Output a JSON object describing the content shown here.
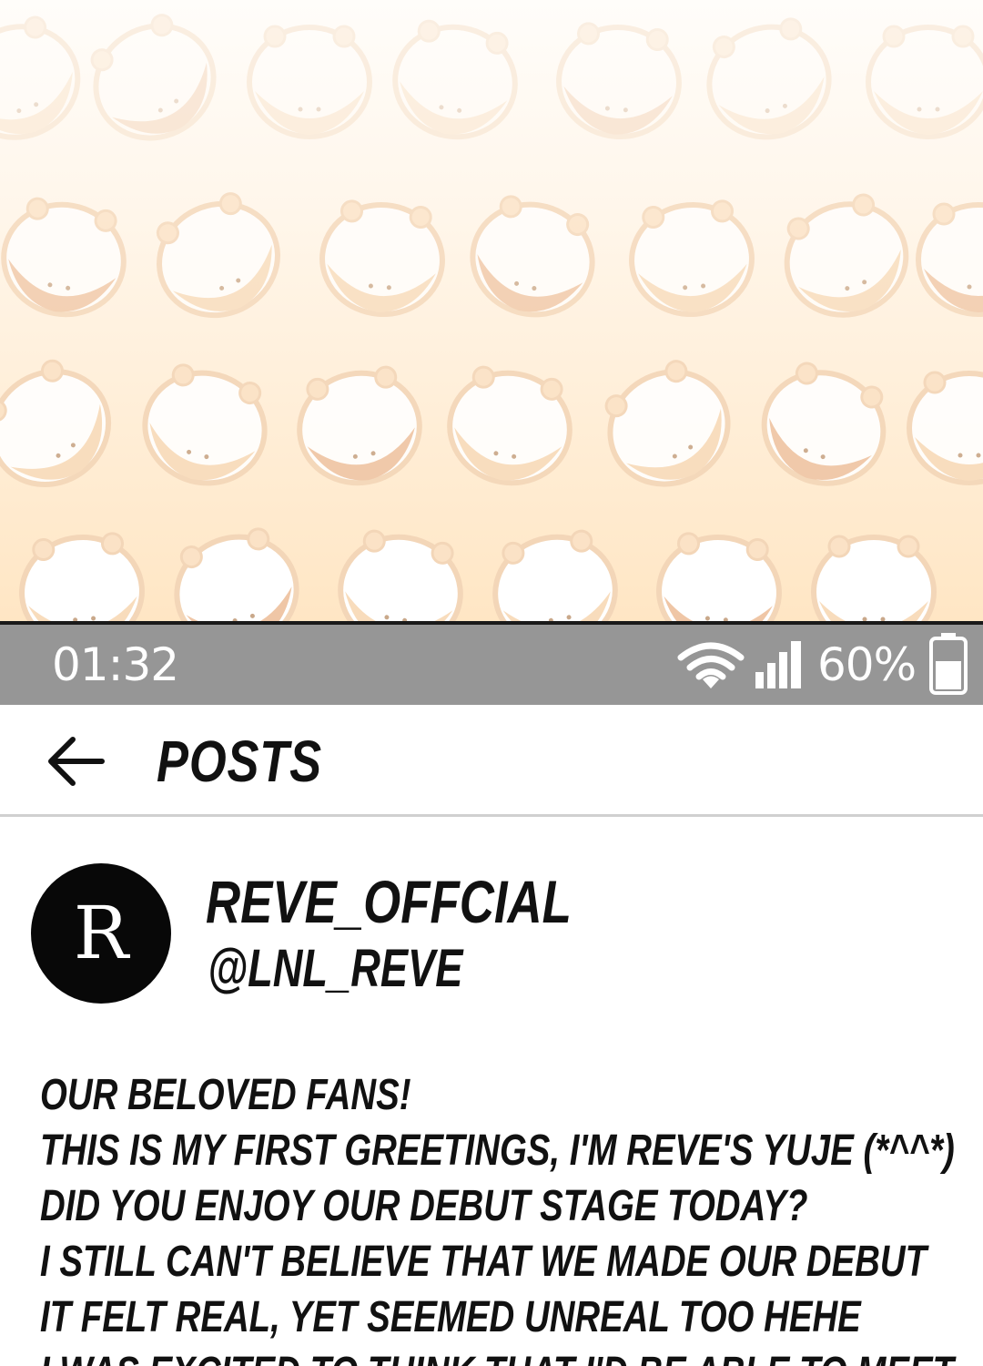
{
  "status_bar": {
    "time": "01:32",
    "battery_percent": "60%",
    "battery_level": 0.6,
    "icons": [
      "wifi-icon",
      "signal-icon",
      "battery-icon"
    ]
  },
  "header": {
    "title": "POSTS",
    "back_icon": "arrow-left-icon"
  },
  "profile": {
    "avatar_letter": "R",
    "display_name": "REVE_OFFCIAL",
    "handle": "@LNL_REVE"
  },
  "post": {
    "lines": [
      "OUR BELOVED FANS!",
      "THIS IS MY FIRST GREETINGS, I'M REVE'S YUJE (*^^*)",
      "DID YOU ENJOY OUR DEBUT STAGE TODAY?",
      "I STILL CAN'T BELIEVE THAT WE MADE OUR DEBUT",
      "IT FELT REAL, YET SEEMED UNREAL TOO HEHE",
      "I WAS EXCITED TO THINK THAT I'D BE ABLE TO MEET"
    ]
  },
  "colors": {
    "status_bar_bg": "#969696",
    "avatar_bg": "#080808",
    "text": "#111111",
    "background_gradient_bottom": "#ffe6c4"
  }
}
